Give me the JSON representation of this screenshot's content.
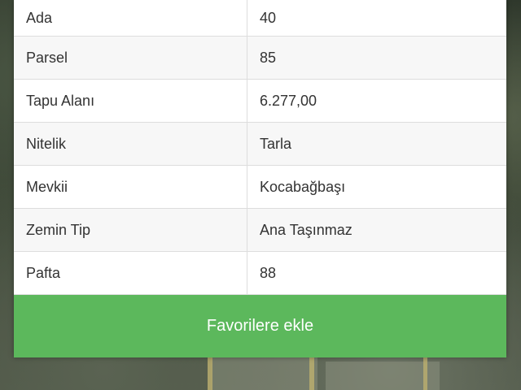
{
  "parcel_info": {
    "rows": [
      {
        "label": "Ada",
        "value": "40"
      },
      {
        "label": "Parsel",
        "value": "85"
      },
      {
        "label": "Tapu Alanı",
        "value": "6.277,00"
      },
      {
        "label": "Nitelik",
        "value": "Tarla"
      },
      {
        "label": "Mevkii",
        "value": "Kocabağbaşı"
      },
      {
        "label": "Zemin Tip",
        "value": "Ana Taşınmaz"
      },
      {
        "label": "Pafta",
        "value": "88"
      }
    ]
  },
  "actions": {
    "favorite_label": "Favorilere ekle",
    "favorite_color": "#5cb85c"
  }
}
